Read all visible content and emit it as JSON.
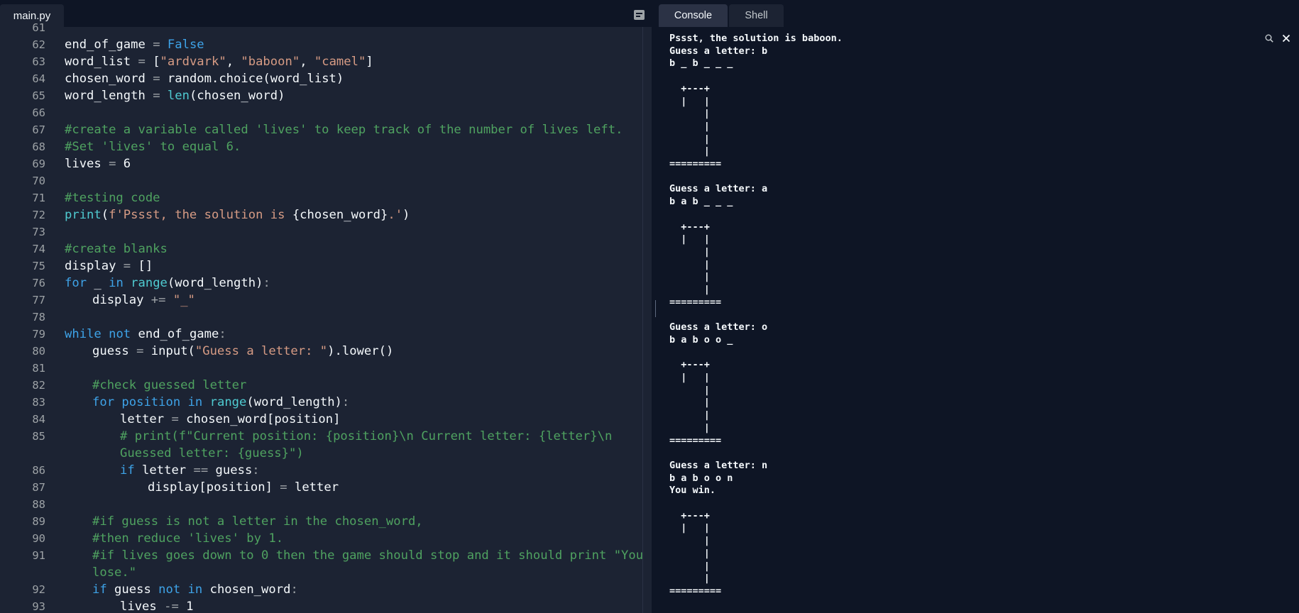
{
  "editor": {
    "tab_label": "main.py",
    "lines": [
      {
        "n": "61",
        "indent": 0,
        "tokens": [
          [
            "",
            ""
          ]
        ]
      },
      {
        "n": "62",
        "indent": 0,
        "tokens": [
          [
            "end_of_game ",
            ""
          ],
          [
            "=",
            "op"
          ],
          [
            " ",
            ""
          ],
          [
            "False",
            "bl"
          ]
        ]
      },
      {
        "n": "63",
        "indent": 0,
        "tokens": [
          [
            "word_list ",
            ""
          ],
          [
            "=",
            "op"
          ],
          [
            " [",
            ""
          ],
          [
            "\"ardvark\"",
            "st"
          ],
          [
            ", ",
            ""
          ],
          [
            "\"baboon\"",
            "st"
          ],
          [
            ", ",
            ""
          ],
          [
            "\"camel\"",
            "st"
          ],
          [
            "]",
            ""
          ]
        ]
      },
      {
        "n": "64",
        "indent": 0,
        "tokens": [
          [
            "chosen_word ",
            ""
          ],
          [
            "=",
            "op"
          ],
          [
            " random.choice(word_list)",
            ""
          ]
        ]
      },
      {
        "n": "65",
        "indent": 0,
        "tokens": [
          [
            "word_length ",
            ""
          ],
          [
            "=",
            "op"
          ],
          [
            " ",
            ""
          ],
          [
            "len",
            "fn"
          ],
          [
            "(chosen_word)",
            ""
          ]
        ]
      },
      {
        "n": "66",
        "indent": 0,
        "tokens": [
          [
            "",
            ""
          ]
        ]
      },
      {
        "n": "67",
        "indent": 0,
        "tokens": [
          [
            "#create a variable called 'lives' to keep track of the number of lives left.",
            "cm"
          ]
        ]
      },
      {
        "n": "68",
        "indent": 0,
        "tokens": [
          [
            "#Set 'lives' to equal 6.",
            "cm"
          ]
        ]
      },
      {
        "n": "69",
        "indent": 0,
        "tokens": [
          [
            "lives ",
            ""
          ],
          [
            "=",
            "op"
          ],
          [
            " 6",
            ""
          ]
        ]
      },
      {
        "n": "70",
        "indent": 0,
        "tokens": [
          [
            "",
            ""
          ]
        ]
      },
      {
        "n": "71",
        "indent": 0,
        "tokens": [
          [
            "#testing code",
            "cm"
          ]
        ]
      },
      {
        "n": "72",
        "indent": 0,
        "tokens": [
          [
            "print",
            "fn"
          ],
          [
            "(",
            ""
          ],
          [
            "f'Pssst, the solution is ",
            "st"
          ],
          [
            "{chosen_word}",
            ""
          ],
          [
            ".'",
            "st"
          ],
          [
            ")",
            ""
          ]
        ]
      },
      {
        "n": "73",
        "indent": 0,
        "tokens": [
          [
            "",
            ""
          ]
        ]
      },
      {
        "n": "74",
        "indent": 0,
        "tokens": [
          [
            "#create blanks",
            "cm"
          ]
        ]
      },
      {
        "n": "75",
        "indent": 0,
        "tokens": [
          [
            "display ",
            ""
          ],
          [
            "=",
            "op"
          ],
          [
            " []",
            ""
          ]
        ]
      },
      {
        "n": "76",
        "indent": 0,
        "tokens": [
          [
            "for",
            "kw"
          ],
          [
            " _ ",
            ""
          ],
          [
            "in",
            "kw"
          ],
          [
            " ",
            ""
          ],
          [
            "range",
            "fn"
          ],
          [
            "(word_length)",
            ""
          ],
          [
            ":",
            "op"
          ]
        ]
      },
      {
        "n": "77",
        "indent": 1,
        "tokens": [
          [
            "display ",
            ""
          ],
          [
            "+=",
            "op"
          ],
          [
            " ",
            ""
          ],
          [
            "\"_\"",
            "st"
          ]
        ]
      },
      {
        "n": "78",
        "indent": 0,
        "tokens": [
          [
            "",
            ""
          ]
        ]
      },
      {
        "n": "79",
        "indent": 0,
        "tokens": [
          [
            "while",
            "kw"
          ],
          [
            " ",
            ""
          ],
          [
            "not",
            "kw"
          ],
          [
            " end_of_game",
            ""
          ],
          [
            ":",
            "op"
          ]
        ]
      },
      {
        "n": "80",
        "indent": 1,
        "tokens": [
          [
            "guess ",
            ""
          ],
          [
            "=",
            "op"
          ],
          [
            " input(",
            ""
          ],
          [
            "\"Guess a letter: \"",
            "st"
          ],
          [
            ").lower()",
            ""
          ]
        ]
      },
      {
        "n": "81",
        "indent": 0,
        "tokens": [
          [
            "",
            ""
          ]
        ]
      },
      {
        "n": "82",
        "indent": 1,
        "tokens": [
          [
            "#check guessed letter",
            "cm"
          ]
        ]
      },
      {
        "n": "83",
        "indent": 1,
        "tokens": [
          [
            "for",
            "kw"
          ],
          [
            " ",
            ""
          ],
          [
            "position",
            "bl"
          ],
          [
            " ",
            ""
          ],
          [
            "in",
            "kw"
          ],
          [
            " ",
            ""
          ],
          [
            "range",
            "fn"
          ],
          [
            "(word_length)",
            ""
          ],
          [
            ":",
            "op"
          ]
        ]
      },
      {
        "n": "84",
        "indent": 2,
        "tokens": [
          [
            "letter ",
            ""
          ],
          [
            "=",
            "op"
          ],
          [
            " chosen_word[position]",
            ""
          ]
        ]
      },
      {
        "n": "85",
        "indent": 2,
        "tokens": [
          [
            "# print(f\"Current position: {position}\\n Current letter: {letter}\\n",
            "cm"
          ]
        ]
      },
      {
        "n": "",
        "indent": 2,
        "tokens": [
          [
            "Guessed letter: {guess}\")",
            "cm"
          ]
        ]
      },
      {
        "n": "86",
        "indent": 2,
        "tokens": [
          [
            "if",
            "kw"
          ],
          [
            " letter ",
            ""
          ],
          [
            "==",
            "op"
          ],
          [
            " guess",
            ""
          ],
          [
            ":",
            "op"
          ]
        ]
      },
      {
        "n": "87",
        "indent": 3,
        "tokens": [
          [
            "display[position] ",
            ""
          ],
          [
            "=",
            "op"
          ],
          [
            " letter",
            ""
          ]
        ]
      },
      {
        "n": "88",
        "indent": 0,
        "tokens": [
          [
            "",
            ""
          ]
        ]
      },
      {
        "n": "89",
        "indent": 1,
        "tokens": [
          [
            "#if guess is not a letter in the chosen_word,",
            "cm"
          ]
        ]
      },
      {
        "n": "90",
        "indent": 1,
        "tokens": [
          [
            "#then reduce 'lives' by 1.",
            "cm"
          ]
        ]
      },
      {
        "n": "91",
        "indent": 1,
        "tokens": [
          [
            "#if lives goes down to 0 then the game should stop and it should print \"You",
            "cm"
          ]
        ]
      },
      {
        "n": "",
        "indent": 1,
        "tokens": [
          [
            "lose.\"",
            "cm"
          ]
        ]
      },
      {
        "n": "92",
        "indent": 1,
        "tokens": [
          [
            "if",
            "kw"
          ],
          [
            " guess ",
            ""
          ],
          [
            "not",
            "kw"
          ],
          [
            " ",
            ""
          ],
          [
            "in",
            "kw"
          ],
          [
            " chosen_word",
            ""
          ],
          [
            ":",
            "op"
          ]
        ]
      },
      {
        "n": "93",
        "indent": 2,
        "tokens": [
          [
            "lives ",
            ""
          ],
          [
            "-=",
            "op"
          ],
          [
            " 1",
            ""
          ]
        ]
      }
    ]
  },
  "tabs": {
    "console_label": "Console",
    "shell_label": "Shell"
  },
  "console": {
    "output": "Pssst, the solution is baboon.\nGuess a letter: b\nb _ b _ _ _\n\n  +---+\n  |   |\n      |\n      |\n      |\n      |\n=========\n\nGuess a letter: a\nb a b _ _ _\n\n  +---+\n  |   |\n      |\n      |\n      |\n      |\n=========\n\nGuess a letter: o\nb a b o o _\n\n  +---+\n  |   |\n      |\n      |\n      |\n      |\n=========\n\nGuess a letter: n\nb a b o o n\nYou win.\n\n  +---+\n  |   |\n      |\n      |\n      |\n      |\n=========",
    "search_icon": "search-icon",
    "close_icon": "close-icon"
  },
  "colors": {
    "editor_bg": "#1c2333",
    "console_bg": "#0e1525",
    "keyword": "#3ea3e8",
    "builtin": "#4fcbd1",
    "string": "#d69b84",
    "comment": "#4fa260"
  }
}
